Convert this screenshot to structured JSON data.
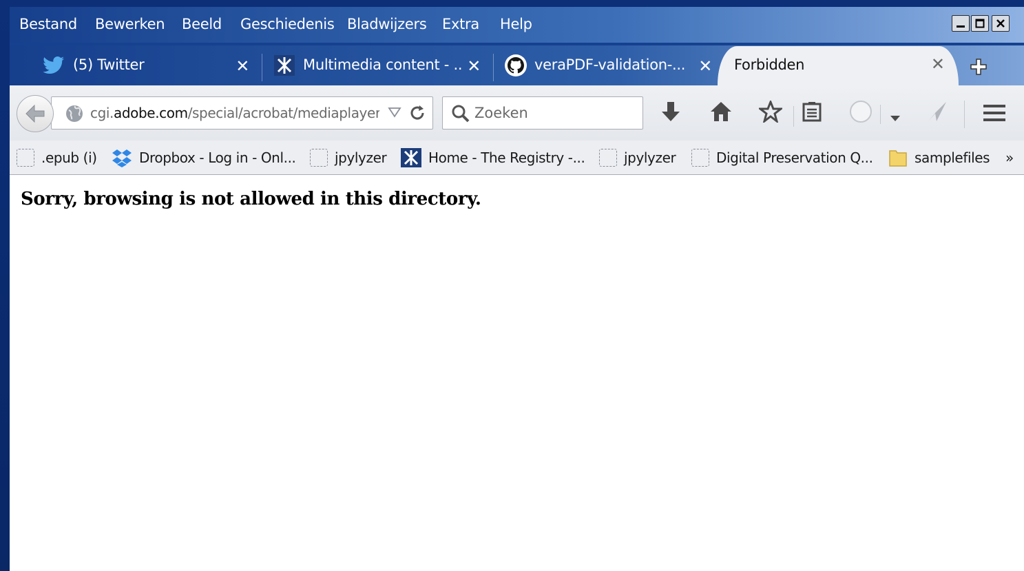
{
  "menubar": {
    "items": [
      "Bestand",
      "Bewerken",
      "Beeld",
      "Geschiedenis",
      "Bladwijzers",
      "Extra",
      "Help"
    ]
  },
  "tabs": [
    {
      "title": "(5) Twitter",
      "icon": "twitter-bird-icon",
      "active": false
    },
    {
      "title": "Multimedia content - ...",
      "icon": "registry-logo-icon",
      "active": false
    },
    {
      "title": "veraPDF-validation-...",
      "icon": "github-octocat-icon",
      "active": false
    },
    {
      "title": "Forbidden",
      "icon": "none",
      "active": true
    }
  ],
  "navbar": {
    "url_prefix": "cgi.",
    "url_domain": "adobe.com",
    "url_path": "/special/acrobat/mediaplayer",
    "search_placeholder": "Zoeken"
  },
  "bookmarks": [
    {
      "label": ".epub (i)",
      "icon": "blank-page-icon"
    },
    {
      "label": "Dropbox - Log in - Onl...",
      "icon": "dropbox-icon"
    },
    {
      "label": "jpylyzer",
      "icon": "blank-page-icon"
    },
    {
      "label": "Home - The Registry -...",
      "icon": "registry-logo-icon"
    },
    {
      "label": "jpylyzer",
      "icon": "blank-page-icon"
    },
    {
      "label": "Digital Preservation Q...",
      "icon": "blank-page-icon"
    },
    {
      "label": "samplefiles",
      "icon": "folder-icon"
    }
  ],
  "bookmarks_overflow": "»",
  "content": {
    "message": "Sorry, browsing is not allowed in this directory."
  },
  "colors": {
    "titlebar": "#163f8c",
    "chrome": "#eef0f3",
    "page_bg": "#ffffff"
  }
}
